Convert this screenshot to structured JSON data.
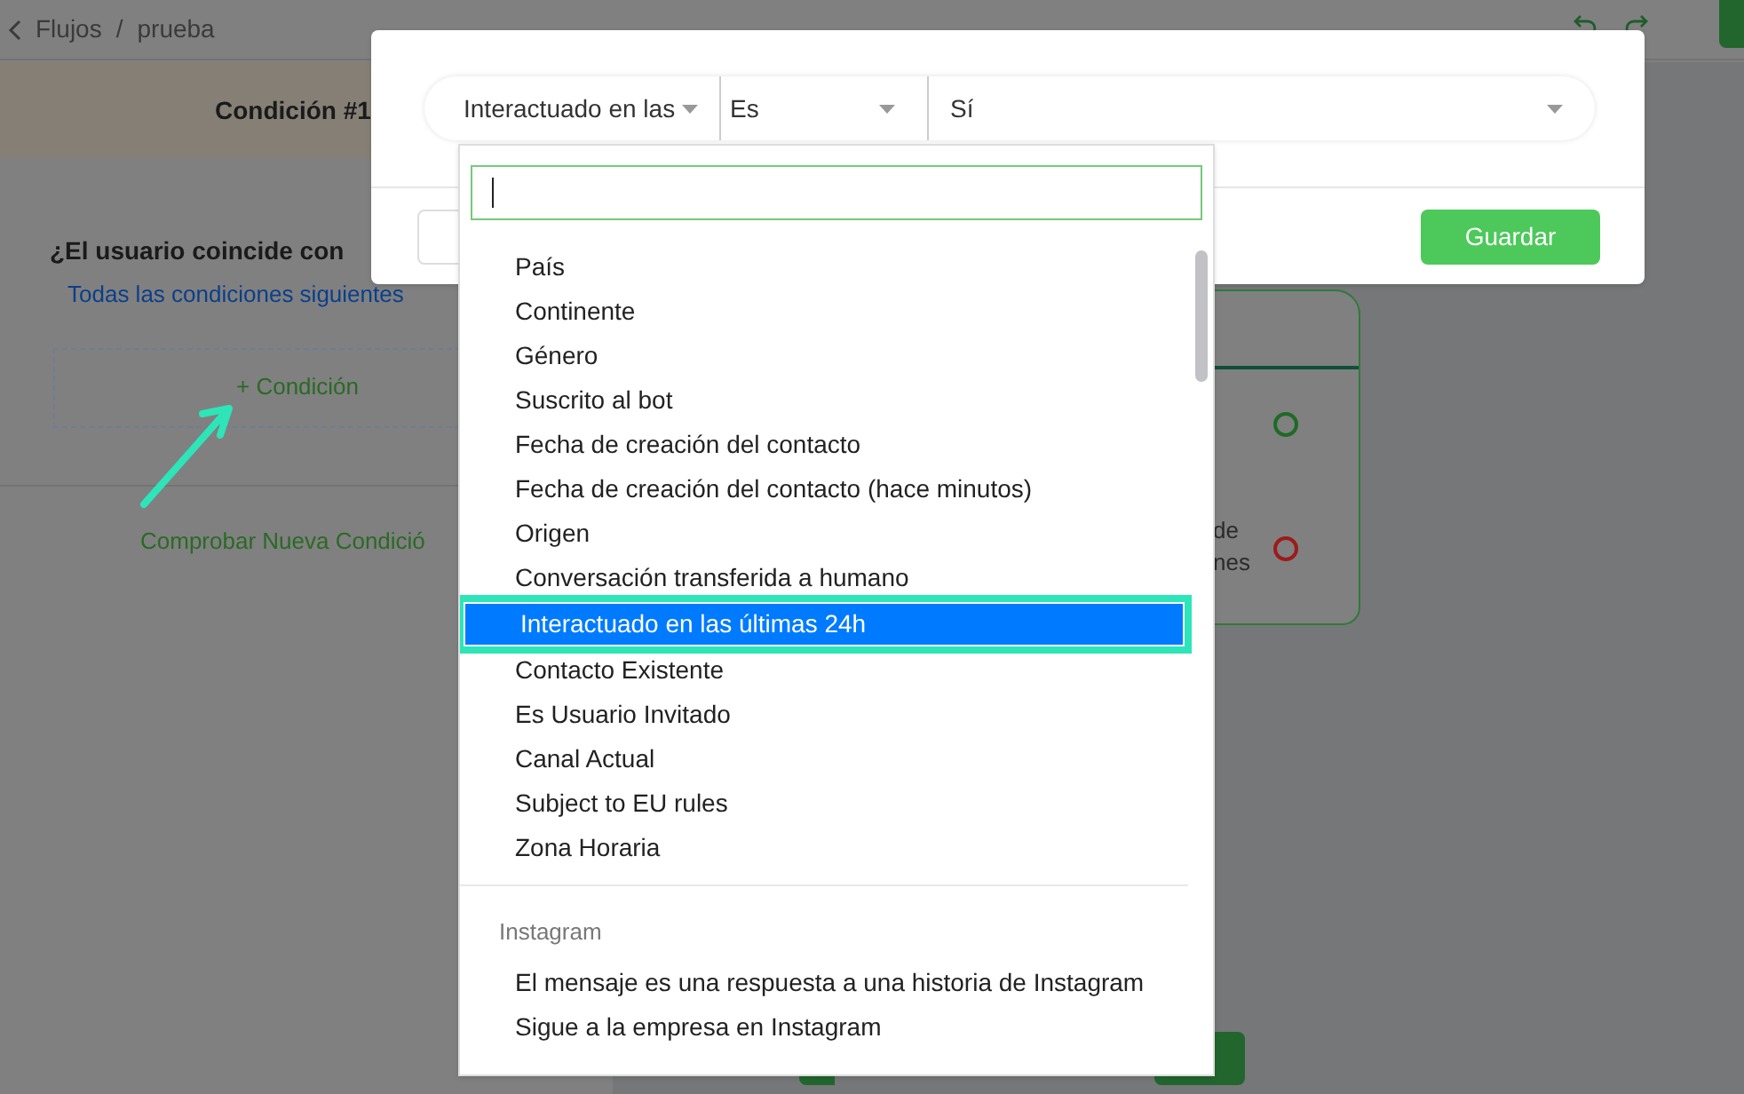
{
  "breadcrumb": {
    "back": "Flujos",
    "separator": "/",
    "current": "prueba"
  },
  "panel": {
    "title": "Condición #1",
    "question": "¿El usuario coincide con",
    "match_mode": "Todas las condiciones siguientes",
    "add_condition": "+ Condición",
    "check_new": "Comprobar Nueva Condició"
  },
  "card": {
    "lines": [
      "de",
      "nes"
    ]
  },
  "modal": {
    "filters": [
      {
        "value": "Interactuado en las"
      },
      {
        "value": "Es"
      },
      {
        "value": "Sí"
      }
    ],
    "save": "Guardar"
  },
  "dropdown": {
    "groups": [
      {
        "items": [
          {
            "label": "País",
            "selected": false
          },
          {
            "label": "Continente",
            "selected": false
          },
          {
            "label": "Género",
            "selected": false
          },
          {
            "label": "Suscrito al bot",
            "selected": false
          },
          {
            "label": "Fecha de creación del contacto",
            "selected": false
          },
          {
            "label": "Fecha de creación del contacto (hace minutos)",
            "selected": false
          },
          {
            "label": "Origen",
            "selected": false
          },
          {
            "label": "Conversación transferida a humano",
            "selected": false
          },
          {
            "label": "Interactuado en las últimas 24h",
            "selected": true
          },
          {
            "label": "Contacto Existente",
            "selected": false
          },
          {
            "label": "Es Usuario Invitado",
            "selected": false
          },
          {
            "label": "Canal Actual",
            "selected": false
          },
          {
            "label": "Subject to EU rules",
            "selected": false
          },
          {
            "label": "Zona Horaria",
            "selected": false
          }
        ]
      },
      {
        "label": "Instagram",
        "items": [
          {
            "label": "El mensaje es una respuesta a una historia de Instagram",
            "selected": false
          },
          {
            "label": "Sigue a la empresa en Instagram",
            "selected": false
          }
        ]
      }
    ]
  }
}
